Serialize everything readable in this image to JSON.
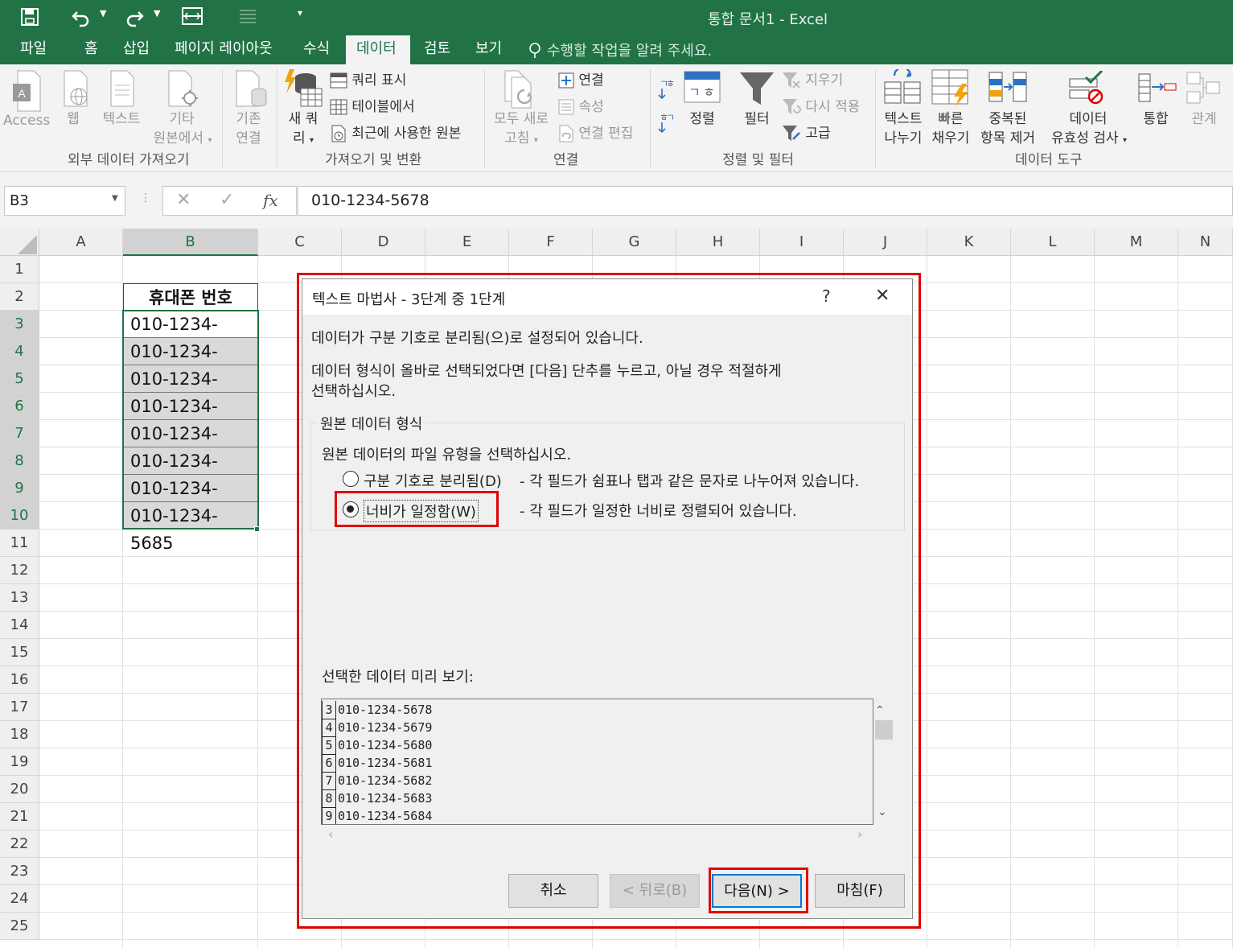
{
  "window": {
    "title": "통합 문서1 - Excel"
  },
  "tabs": [
    "파일",
    "홈",
    "삽입",
    "페이지 레이아웃",
    "수식",
    "데이터",
    "검토",
    "보기"
  ],
  "tell_me": "수행할 작업을 알려 주세요.",
  "ribbon": {
    "get_external": {
      "group": "외부 데이터 가져오기",
      "access": "Access",
      "web": "웹",
      "text": "텍스트",
      "other1": "기타",
      "other2": "원본에서",
      "existing1": "기존",
      "existing2": "연결"
    },
    "get_transform": {
      "group": "가져오기 및 변환",
      "new_query1": "새 쿼",
      "new_query2": "리",
      "show_queries": "쿼리 표시",
      "from_table": "테이블에서",
      "recent_sources": "최근에 사용한 원본"
    },
    "connections": {
      "group": "연결",
      "refresh1": "모두 새로",
      "refresh2": "고침",
      "connections": "연결",
      "properties": "속성",
      "edit_links": "연결 편집"
    },
    "sort_filter": {
      "group": "정렬 및 필터",
      "sort": "정렬",
      "filter": "필터",
      "clear": "지우기",
      "reapply": "다시 적용",
      "advanced": "고급"
    },
    "data_tools": {
      "group": "데이터 도구",
      "text_to_columns1": "텍스트",
      "text_to_columns2": "나누기",
      "flash_fill1": "빠른",
      "flash_fill2": "채우기",
      "remove_dup1": "중복된",
      "remove_dup2": "항목 제거",
      "validation1": "데이터",
      "validation2": "유효성 검사",
      "consolidate": "통합",
      "relationships": "관계"
    }
  },
  "formula_bar": {
    "name_box": "B3",
    "fx": "fx",
    "value": "010-1234-5678"
  },
  "columns": [
    "A",
    "B",
    "C",
    "D",
    "E",
    "F",
    "G",
    "H",
    "I",
    "J",
    "K",
    "L",
    "M",
    "N"
  ],
  "rows": [
    "1",
    "2",
    "3",
    "4",
    "5",
    "6",
    "7",
    "8",
    "9",
    "10",
    "11",
    "12",
    "13",
    "14",
    "15",
    "16",
    "17",
    "18",
    "19",
    "20",
    "21",
    "22",
    "23",
    "24",
    "25"
  ],
  "cells": {
    "header": "휴대폰 번호",
    "phones": [
      "010-1234-5678",
      "010-1234-5679",
      "010-1234-5680",
      "010-1234-5681",
      "010-1234-5682",
      "010-1234-5683",
      "010-1234-5684",
      "010-1234-5685"
    ]
  },
  "dialog": {
    "title": "텍스트 마법사 - 3단계 중 1단계",
    "help": "?",
    "line1": "데이터가 구분 기호로 분리됨(으)로 설정되어 있습니다.",
    "line2a": "데이터 형식이 올바로 선택되었다면 [다음] 단추를 누르고, 아닐 경우 적절하게",
    "line2b": "선택하십시오.",
    "group_title": "원본 데이터 형식",
    "choose": "원본 데이터의 파일 유형을 선택하십시오.",
    "opt_delimited": "구분 기호로 분리됨(D)",
    "opt_delimited_desc": "- 각 필드가 쉼표나 탭과 같은 문자로 나누어져 있습니다.",
    "opt_fixed": "너비가 일정함(W)",
    "opt_fixed_desc": "- 각 필드가 일정한 너비로 정렬되어 있습니다.",
    "selected_option": "fixed",
    "preview_label": "선택한 데이터 미리 보기:",
    "preview": [
      {
        "n": "3",
        "v": "010-1234-5678"
      },
      {
        "n": "4",
        "v": "010-1234-5679"
      },
      {
        "n": "5",
        "v": "010-1234-5680"
      },
      {
        "n": "6",
        "v": "010-1234-5681"
      },
      {
        "n": "7",
        "v": "010-1234-5682"
      },
      {
        "n": "8",
        "v": "010-1234-5683"
      },
      {
        "n": "9",
        "v": "010-1234-5684"
      }
    ],
    "buttons": {
      "cancel": "취소",
      "back": "< 뒤로(B)",
      "next": "다음(N) >",
      "finish": "마침(F)"
    }
  },
  "colors": {
    "excel_green": "#217346",
    "highlight_red": "#e00000",
    "focus_blue": "#0078d7"
  }
}
